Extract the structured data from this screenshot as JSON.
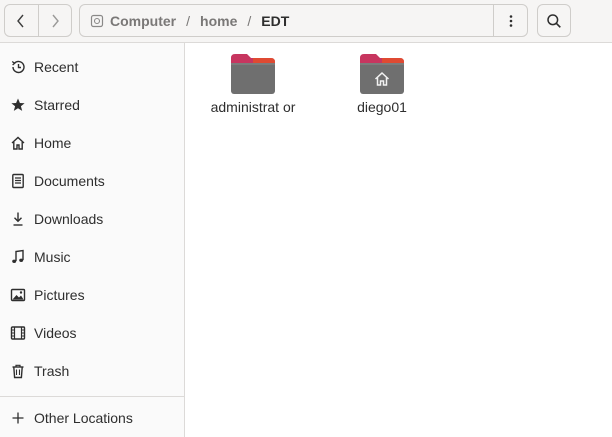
{
  "header": {
    "back_icon": "chevron-left-icon",
    "forward_icon": "chevron-right-icon",
    "path": [
      "Computer",
      "home",
      "EDT"
    ],
    "separator": "/",
    "path_menu_icon": "vertical-dots-icon",
    "search_icon": "search-icon"
  },
  "sidebar": {
    "items": [
      {
        "label": "Recent",
        "icon": "clock-icon"
      },
      {
        "label": "Starred",
        "icon": "star-icon"
      },
      {
        "label": "Home",
        "icon": "home-icon"
      },
      {
        "label": "Documents",
        "icon": "document-icon"
      },
      {
        "label": "Downloads",
        "icon": "download-icon"
      },
      {
        "label": "Music",
        "icon": "music-note-icon"
      },
      {
        "label": "Pictures",
        "icon": "picture-icon"
      },
      {
        "label": "Videos",
        "icon": "film-icon"
      },
      {
        "label": "Trash",
        "icon": "trash-icon"
      }
    ],
    "other_locations": {
      "label": "Other Locations",
      "icon": "plus-icon"
    }
  },
  "files": [
    {
      "name": "administrat or",
      "icon": "folder-icon"
    },
    {
      "name": "diego01",
      "icon": "home-folder-icon"
    }
  ],
  "colors": {
    "folder_tab": "#c7355f",
    "folder_tab_accent": "#e95420",
    "folder_body": "#6f6f6f",
    "header_bg": "#f6f5f4",
    "sidebar_bg": "#fafafa"
  }
}
